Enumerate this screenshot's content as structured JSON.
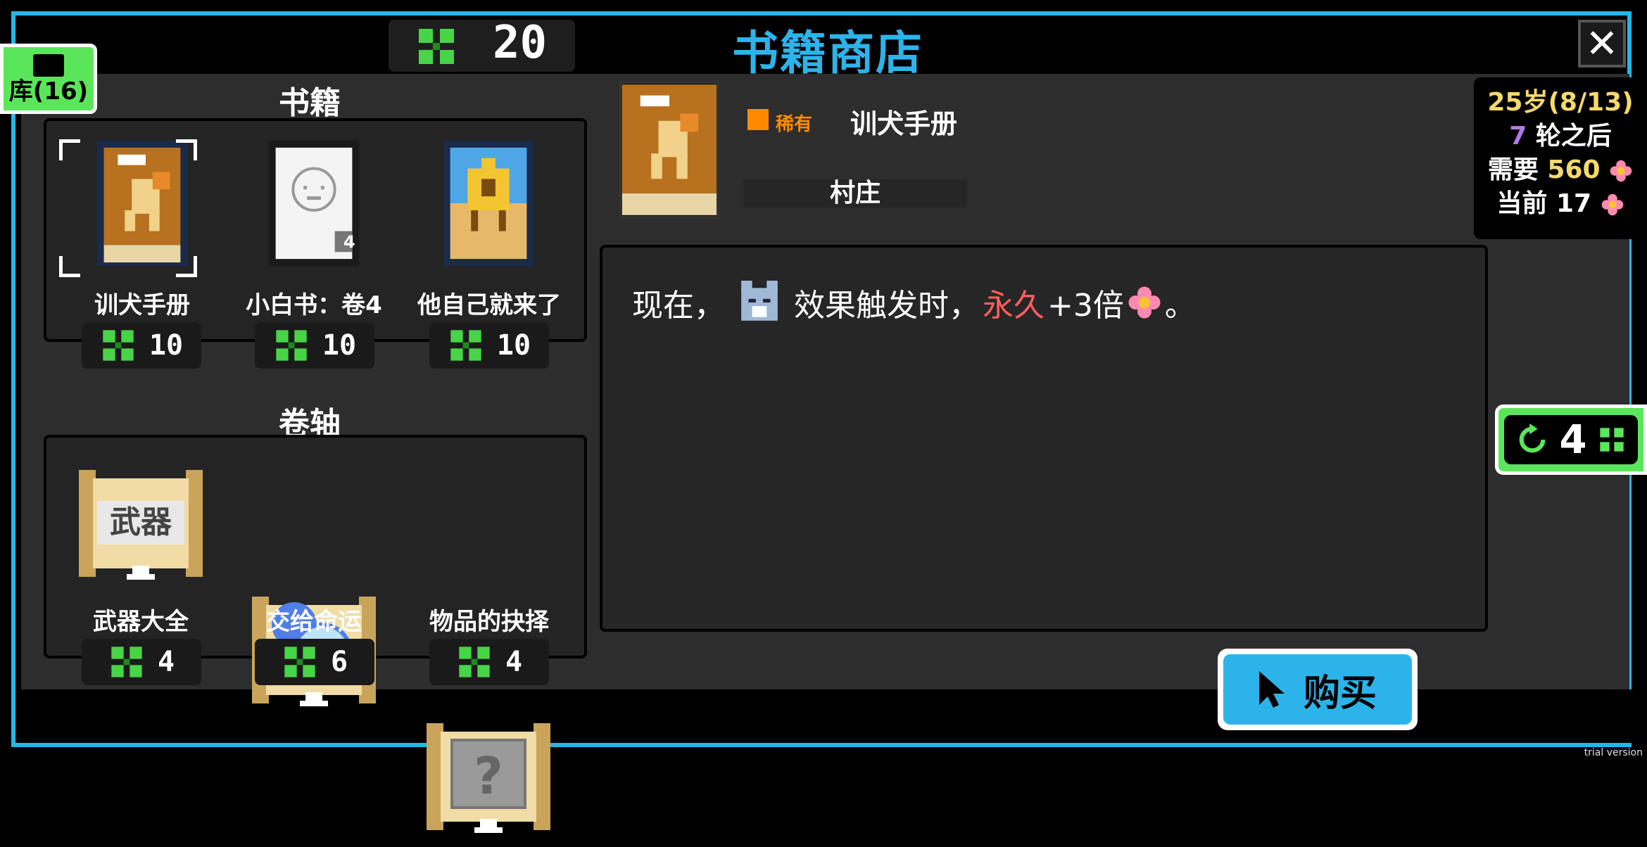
{
  "header": {
    "currency": "20",
    "title": "书籍商店",
    "close": "✕"
  },
  "library_tab": {
    "label": "库(16)"
  },
  "books_section": {
    "title": "书籍",
    "items": [
      {
        "name": "训犬手册",
        "price": "10"
      },
      {
        "name": "小白书：卷4",
        "price": "10",
        "badge": "4"
      },
      {
        "name": "他自己就来了",
        "price": "10"
      }
    ]
  },
  "scrolls_section": {
    "title": "卷轴",
    "items": [
      {
        "name": "武器大全",
        "price": "4",
        "art_text": "武器"
      },
      {
        "name": "交给命运",
        "price": "6"
      },
      {
        "name": "物品的抉择",
        "price": "4"
      }
    ]
  },
  "detail": {
    "rarity": "稀有",
    "name": "训犬手册",
    "category": "村庄",
    "desc_prefix": "现在，",
    "desc_mid": "效果触发时，",
    "desc_red": "永久",
    "desc_suffix": "+3倍",
    "desc_end": "。"
  },
  "info": {
    "age": "25岁(8/13)",
    "rounds_num": "7",
    "rounds_text": "轮之后",
    "need_label": "需要",
    "need_value": "560",
    "current_label": "当前",
    "current_value": "17"
  },
  "reroll": {
    "count": "4"
  },
  "buy": {
    "label": "购买"
  },
  "watermark": "trial version",
  "colors": {
    "accent": "#2cb4ea",
    "green": "#5ae65a",
    "rare": "#ff8a00",
    "red": "#ff5d5d"
  }
}
